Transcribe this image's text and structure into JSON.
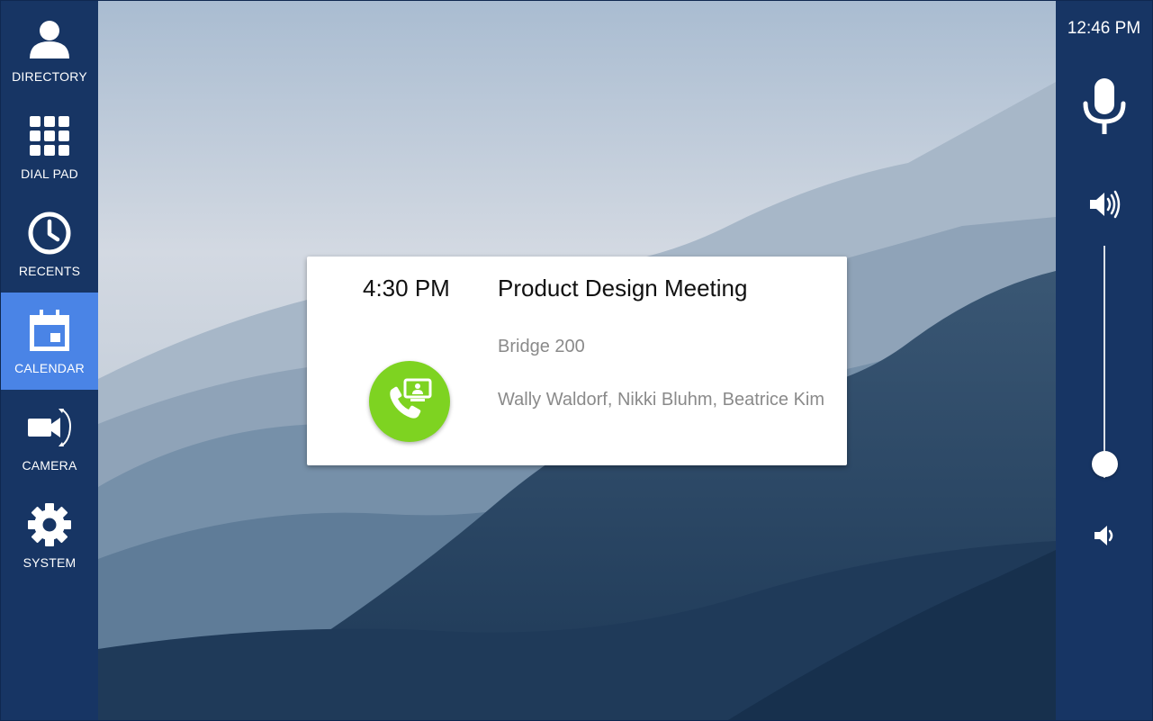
{
  "nav": {
    "items": [
      {
        "id": "directory",
        "label": "DIRECTORY",
        "icon": "person-icon",
        "active": false
      },
      {
        "id": "dialpad",
        "label": "DIAL PAD",
        "icon": "dialpad-grid-icon",
        "active": false
      },
      {
        "id": "recents",
        "label": "RECENTS",
        "icon": "clock-icon",
        "active": false
      },
      {
        "id": "calendar",
        "label": "CALENDAR",
        "icon": "calendar-icon",
        "active": true
      },
      {
        "id": "camera",
        "label": "CAMERA",
        "icon": "camera-switch-icon",
        "active": false
      },
      {
        "id": "system",
        "label": "SYSTEM",
        "icon": "gear-icon",
        "active": false
      }
    ]
  },
  "status": {
    "time": "12:46 PM"
  },
  "audio": {
    "volume_level": 0.06
  },
  "meeting": {
    "time": "4:30 PM",
    "title": "Product Design Meeting",
    "location": "Bridge 200",
    "attendees": "Wally Waldorf, Nikki Bluhm, Beatrice Kim"
  },
  "colors": {
    "nav_bg": "#173564",
    "nav_active": "#4a84e6",
    "join_button": "#7ed321",
    "card_bg": "#ffffff"
  }
}
